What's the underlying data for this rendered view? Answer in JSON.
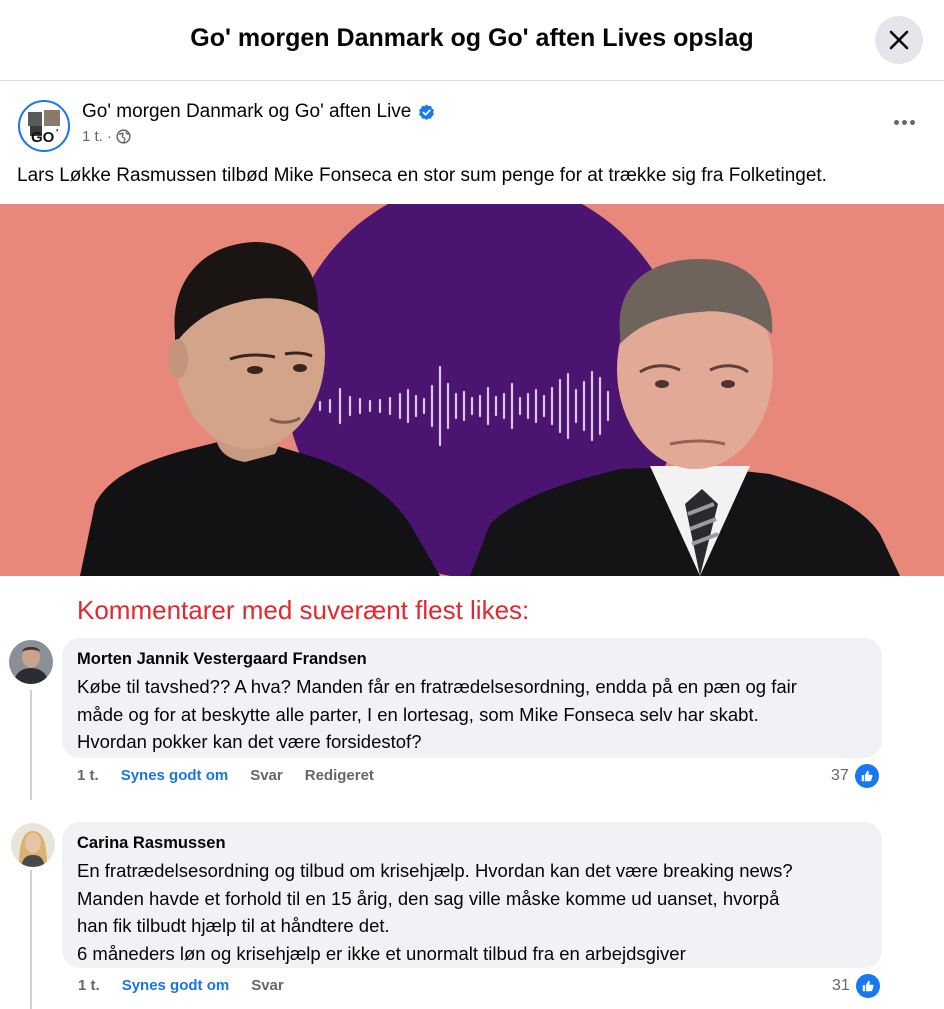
{
  "dialog": {
    "title": "Go' morgen Danmark og Go' aften Lives opslag",
    "close_icon": "close-icon"
  },
  "post": {
    "page_name": "Go' morgen Danmark og Go' aften Live",
    "verified_icon": "verified-badge-icon",
    "time": "1 t.",
    "separator": "·",
    "audience_icon": "globe-icon",
    "text": "Lars Løkke Rasmussen tilbød Mike Fonseca en stor sum penge for at trække sig fra Folketinget.",
    "image": {
      "description_icon": "post-photo",
      "background_color": "#e8887a",
      "circle_color": "#4a1470"
    }
  },
  "annotation": {
    "text": "Kommentarer med suverænt flest likes:",
    "color": "#e0282d"
  },
  "comments": [
    {
      "author": "Morten Jannik Vestergaard Frandsen",
      "lines": [
        "Købe til tavshed?? A hva? Manden får en fratrædelsesordning, endda på en pæn og fair",
        "måde og for at beskytte alle parter, I en lortesag, som Mike Fonseca selv har skabt.",
        "Hvordan pokker kan det være forsidestof?"
      ],
      "time": "1 t.",
      "like_label": "Synes godt om",
      "reply_label": "Svar",
      "edited_label": "Redigeret",
      "likes": "37"
    },
    {
      "author": "Carina Rasmussen",
      "lines": [
        "En fratrædelsesordning og tilbud om krisehjælp. Hvordan kan det være breaking news?",
        "Manden havde et forhold til en 15 årig, den sag ville måske komme ud uanset, hvorpå",
        "han fik tilbudt hjælp til at håndtere det.",
        "6 måneders løn og krisehjælp er ikke et unormalt tilbud fra en arbejdsgiver"
      ],
      "time": "1 t.",
      "like_label": "Synes godt om",
      "reply_label": "Svar",
      "likes": "31"
    }
  ],
  "colors": {
    "facebook_blue": "#1877f2",
    "link_blue": "#1b74e4",
    "bubble_gray": "#f0f2f5",
    "secondary_text": "#65676b"
  }
}
